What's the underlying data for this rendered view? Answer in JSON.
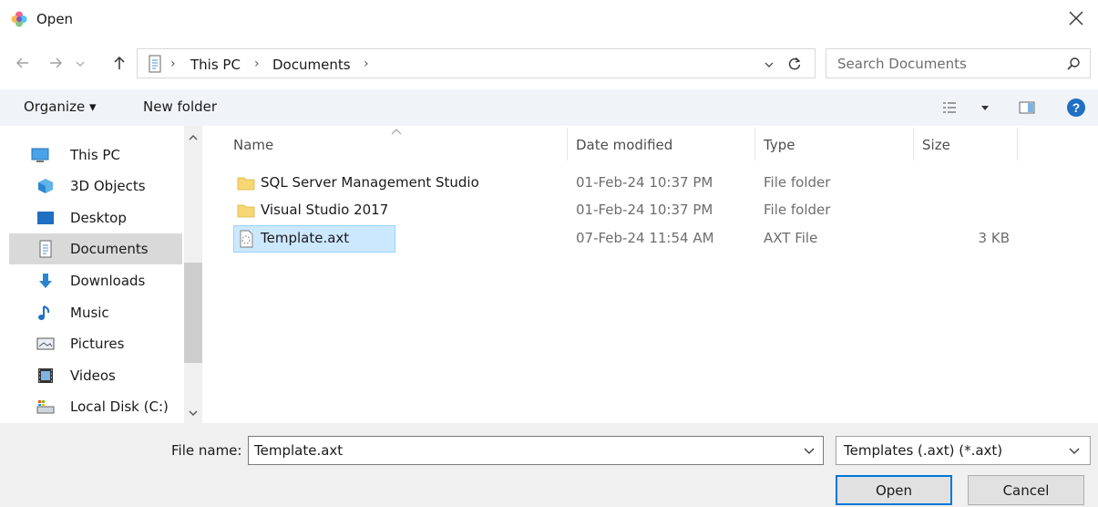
{
  "window": {
    "title": "Open",
    "close_glyph": "✕"
  },
  "address": {
    "path": [
      "This PC",
      "Documents"
    ],
    "separator": "›",
    "search_placeholder": "Search Documents"
  },
  "toolbar": {
    "organize_label": "Organize ▾",
    "new_folder_label": "New folder"
  },
  "nav": {
    "items": [
      {
        "label": "This PC",
        "icon": "computer-icon"
      },
      {
        "label": "3D Objects",
        "icon": "cube-icon"
      },
      {
        "label": "Desktop",
        "icon": "desktop-icon"
      },
      {
        "label": "Documents",
        "icon": "documents-icon",
        "selected": true
      },
      {
        "label": "Downloads",
        "icon": "download-arrow-icon"
      },
      {
        "label": "Music",
        "icon": "music-note-icon"
      },
      {
        "label": "Pictures",
        "icon": "pictures-icon"
      },
      {
        "label": "Videos",
        "icon": "film-icon"
      },
      {
        "label": "Local Disk (C:)",
        "icon": "drive-icon"
      }
    ]
  },
  "list": {
    "columns": [
      "Name",
      "Date modified",
      "Type",
      "Size"
    ],
    "rows": [
      {
        "name": "SQL Server Management Studio",
        "date": "01-Feb-24 10:37 PM",
        "type": "File folder",
        "size": "",
        "icon": "folder-icon"
      },
      {
        "name": "Visual Studio 2017",
        "date": "01-Feb-24 10:37 PM",
        "type": "File folder",
        "size": "",
        "icon": "folder-icon"
      },
      {
        "name": "Template.axt",
        "date": "07-Feb-24 11:54 AM",
        "type": "AXT File",
        "size": "3 KB",
        "icon": "file-icon",
        "selected": true
      }
    ]
  },
  "bottom": {
    "file_name_label": "File name:",
    "file_name_value": "Template.axt",
    "filter_label": "Templates (.axt) (*.axt)",
    "open_label": "Open",
    "cancel_label": "Cancel"
  },
  "colors": {
    "accent": "#0078d7",
    "folder": "#f7d774",
    "selection": "#cce8ff",
    "toolbar_bg": "#f0f4f9"
  }
}
